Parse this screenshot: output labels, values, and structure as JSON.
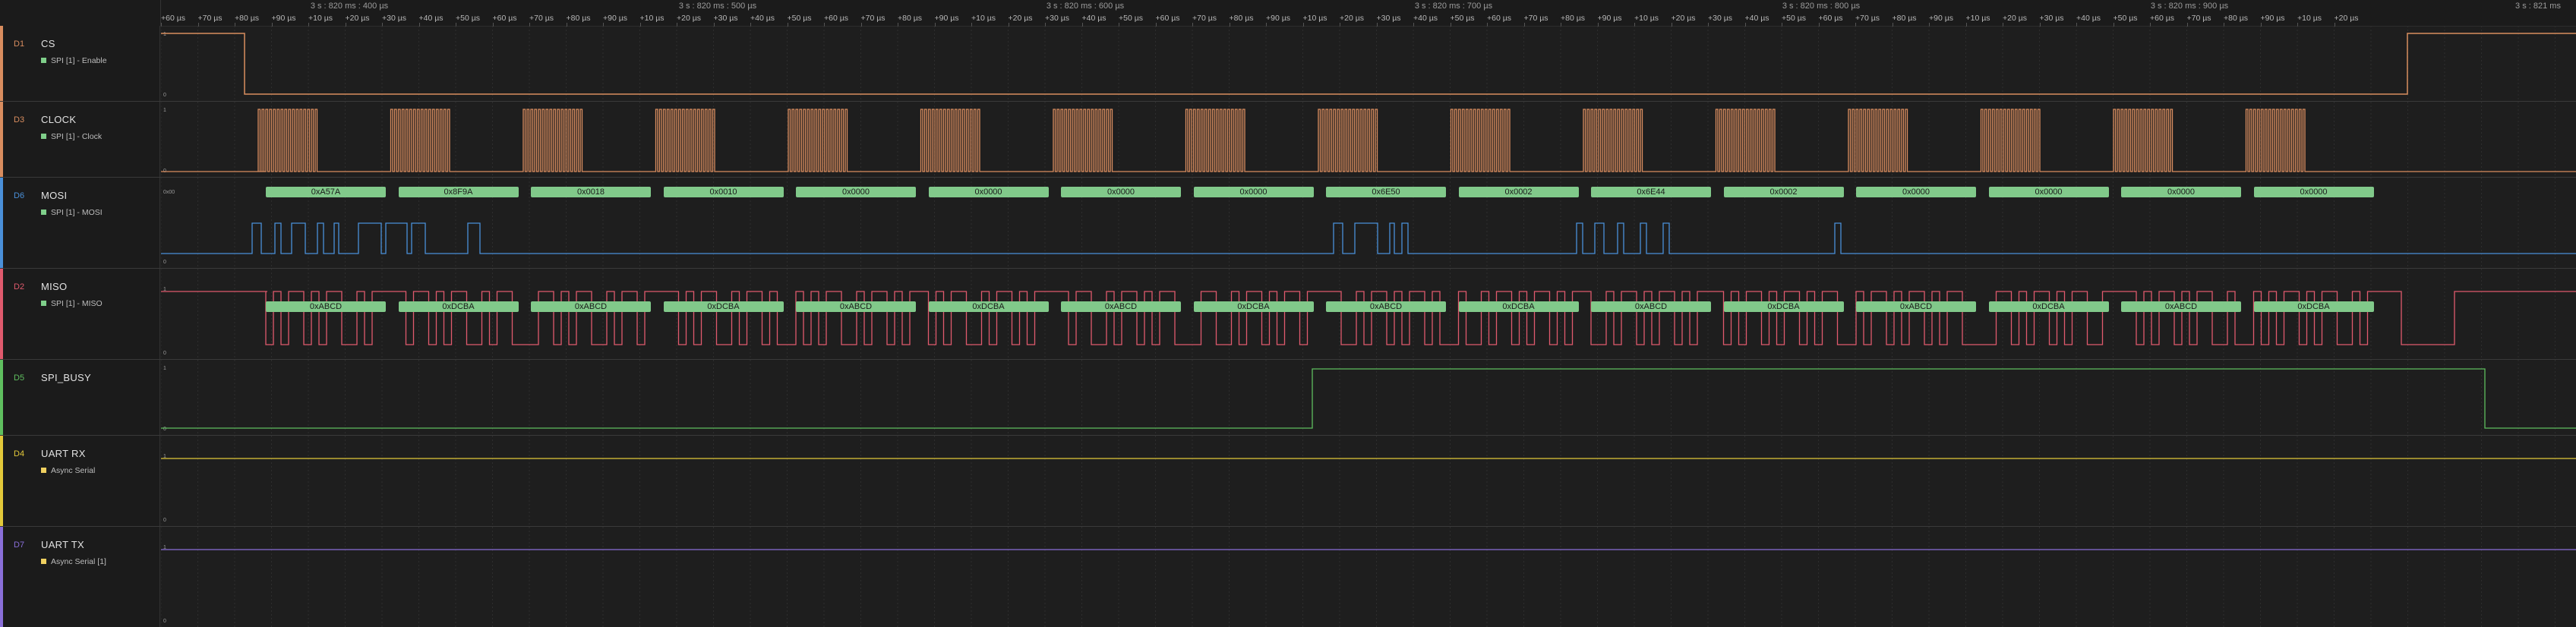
{
  "timeline": {
    "major_labels": [
      "3 s : 820 ms : 400 µs",
      "3 s : 820 ms : 500 µs",
      "3 s : 820 ms : 600 µs",
      "3 s : 820 ms : 700 µs",
      "3 s : 820 ms : 800 µs",
      "3 s : 820 ms : 900 µs",
      "3 s : 821 ms"
    ],
    "tick_labels": [
      "+60 µs",
      "+70 µs",
      "+80 µs",
      "+90 µs",
      "+10 µs",
      "+20 µs",
      "+30 µs",
      "+40 µs",
      "+50 µs",
      "+60 µs",
      "+70 µs",
      "+80 µs",
      "+90 µs",
      "+10 µs",
      "+20 µs",
      "+30 µs",
      "+40 µs",
      "+50 µs",
      "+60 µs",
      "+70 µs",
      "+80 µs",
      "+90 µs",
      "+10 µs",
      "+20 µs",
      "+30 µs",
      "+40 µs",
      "+50 µs",
      "+60 µs",
      "+70 µs",
      "+80 µs",
      "+90 µs",
      "+10 µs",
      "+20 µs",
      "+30 µs",
      "+40 µs",
      "+50 µs",
      "+60 µs",
      "+70 µs",
      "+80 µs",
      "+90 µs",
      "+10 µs",
      "+20 µs",
      "+30 µs",
      "+40 µs",
      "+50 µs",
      "+60 µs",
      "+70 µs",
      "+80 µs",
      "+90 µs",
      "+10 µs",
      "+20 µs",
      "+30 µs",
      "+40 µs",
      "+50 µs",
      "+60 µs",
      "+70 µs",
      "+80 µs",
      "+90 µs",
      "+10 µs",
      "+20 µs"
    ]
  },
  "level_marks": {
    "high": "1",
    "low": "0"
  },
  "channels": [
    {
      "id": "D1",
      "name": "CS",
      "color": "#d98d5f",
      "analyzer": "SPI [1] - Enable",
      "analyzer_color": "#7fcf8a"
    },
    {
      "id": "D3",
      "name": "CLOCK",
      "color": "#d98d5f",
      "analyzer": "SPI [1] - Clock",
      "analyzer_color": "#7fcf8a"
    },
    {
      "id": "D6",
      "name": "MOSI",
      "color": "#4a90d9",
      "analyzer": "SPI [1] - MOSI",
      "analyzer_color": "#7fcf8a"
    },
    {
      "id": "D2",
      "name": "MISO",
      "color": "#e05a6d",
      "analyzer": "SPI [1] - MISO",
      "analyzer_color": "#7fcf8a"
    },
    {
      "id": "D5",
      "name": "SPI_BUSY",
      "color": "#5fbf5f",
      "analyzer": "",
      "analyzer_color": ""
    },
    {
      "id": "D4",
      "name": "UART RX",
      "color": "#e3c93a",
      "analyzer": "Async Serial",
      "analyzer_color": "#f0d060"
    },
    {
      "id": "D7",
      "name": "UART TX",
      "color": "#8a6fd9",
      "analyzer": "Async Serial [1]",
      "analyzer_color": "#f0d060"
    }
  ],
  "mosi_frames": [
    "0xA57A",
    "0x8F9A",
    "0x0018",
    "0x0010",
    "0x0000",
    "0x0000",
    "0x0000",
    "0x0000",
    "0x6E50",
    "0x0002",
    "0x6E44",
    "0x0002",
    "0x0000",
    "0x0000",
    "0x0000",
    "0x0000"
  ],
  "miso_frames": [
    "0xABCD",
    "0xDCBA",
    "0xABCD",
    "0xDCBA",
    "0xABCD",
    "0xDCBA",
    "0xABCD",
    "0xDCBA",
    "0xABCD",
    "0xDCBA",
    "0xABCD",
    "0xDCBA",
    "0xABCD",
    "0xDCBA",
    "0xABCD",
    "0xDCBA"
  ],
  "mosi_idle_label": "0x00"
}
